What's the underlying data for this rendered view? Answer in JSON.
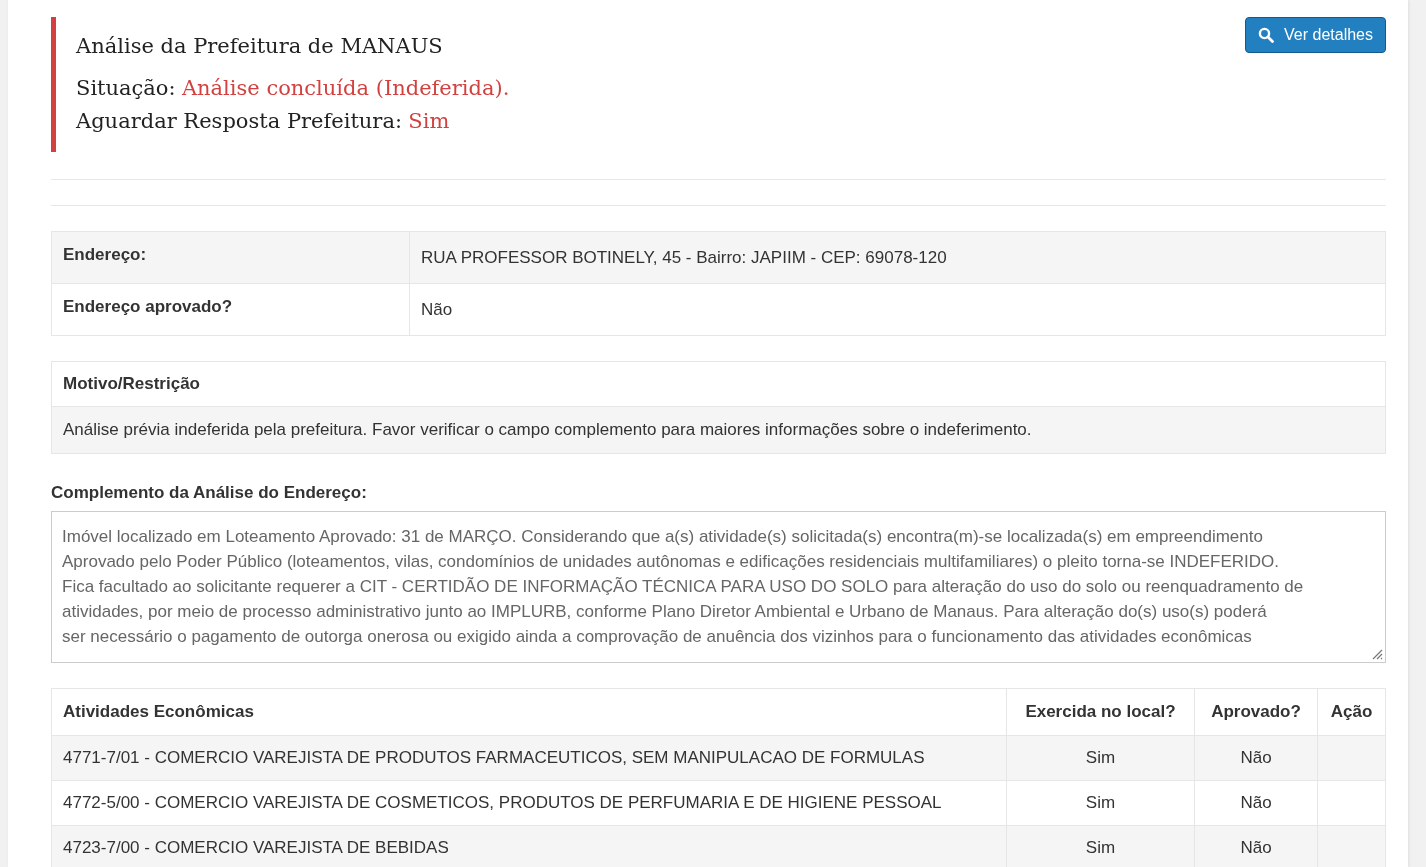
{
  "analysis": {
    "title": "Análise da Prefeitura de MANAUS",
    "status_label": "Situação:",
    "status_value": "Análise concluída (Indeferida).",
    "await_label": "Aguardar Resposta Prefeitura:",
    "await_value": "Sim"
  },
  "details_button": {
    "label": "Ver detalhes"
  },
  "address_table": [
    {
      "label": "Endereço:",
      "value": "RUA PROFESSOR BOTINELY, 45 - Bairro: JAPIIM - CEP: 69078-120"
    },
    {
      "label": "Endereço aprovado?",
      "value": "Não"
    }
  ],
  "restriction": {
    "heading": "Motivo/Restrição",
    "text": "Análise prévia indeferida pela prefeitura. Favor verificar o campo complemento para maiores informações sobre o indeferimento."
  },
  "complement": {
    "label": "Complemento da Análise do Endereço:",
    "lines": [
      "Imóvel localizado em Loteamento Aprovado: 31 de MARÇO. Considerando que a(s) atividade(s) solicitada(s) encontra(m)-se localizada(s) em empreendimento",
      "Aprovado pelo Poder Público (loteamentos, vilas, condomínios de unidades autônomas e edificações residenciais multifamiliares) o pleito torna-se INDEFERIDO.",
      "Fica facultado ao solicitante requerer a CIT - CERTIDÃO DE INFORMAÇÃO TÉCNICA PARA USO DO SOLO para alteração do uso do solo ou reenquadramento de",
      "atividades, por meio de processo administrativo junto ao IMPLURB, conforme Plano Diretor Ambiental e Urbano de Manaus. Para alteração do(s) uso(s) poderá",
      "ser necessário o pagamento de outorga onerosa ou exigido ainda a comprovação de anuência dos vizinhos para o funcionamento das atividades econômicas"
    ]
  },
  "activities": {
    "columns": [
      "Atividades Econômicas",
      "Exercida no local?",
      "Aprovado?",
      "Ação"
    ],
    "rows": [
      {
        "activity": "4771-7/01 - COMERCIO VAREJISTA DE PRODUTOS FARMACEUTICOS, SEM MANIPULACAO DE FORMULAS",
        "exercised": "Sim",
        "approved": "Não"
      },
      {
        "activity": "4772-5/00 - COMERCIO VAREJISTA DE COSMETICOS, PRODUTOS DE PERFUMARIA E DE HIGIENE PESSOAL",
        "exercised": "Sim",
        "approved": "Não"
      },
      {
        "activity": "4723-7/00 - COMERCIO VAREJISTA DE BEBIDAS",
        "exercised": "Sim",
        "approved": "Não"
      }
    ]
  }
}
